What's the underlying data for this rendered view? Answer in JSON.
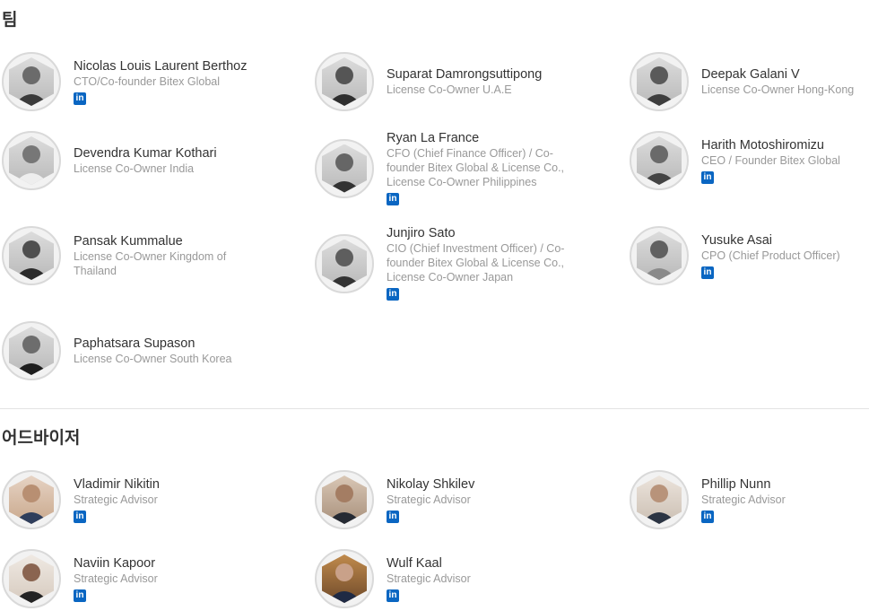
{
  "team": {
    "title": "팀",
    "members": [
      {
        "name": "Nicolas Louis Laurent Berthoz",
        "role": "CTO/Co-founder Bitex Global",
        "linkedin": true
      },
      {
        "name": "Suparat Damrongsuttipong",
        "role": "License Co-Owner U.A.E",
        "linkedin": false
      },
      {
        "name": "Deepak Galani V",
        "role": "License Co-Owner Hong-Kong",
        "linkedin": false
      },
      {
        "name": "Devendra Kumar Kothari",
        "role": "License Co-Owner India",
        "linkedin": false
      },
      {
        "name": "Ryan La France",
        "role": "CFO (Chief Finance Officer) / Co-founder Bitex Global & License Co., License Co-Owner Philippines",
        "linkedin": true
      },
      {
        "name": "Harith Motoshiromizu",
        "role": "CEO / Founder Bitex Global",
        "linkedin": true
      },
      {
        "name": "Pansak Kummalue",
        "role": "License Co-Owner Kingdom of Thailand",
        "linkedin": false
      },
      {
        "name": "Junjiro Sato",
        "role": "CIO (Chief Investment Officer) / Co-founder Bitex Global & License Co., License Co-Owner Japan",
        "linkedin": true
      },
      {
        "name": "Yusuke Asai",
        "role": "CPO (Chief Product Officer)",
        "linkedin": true
      },
      {
        "name": "Paphatsara Supason",
        "role": "License Co-Owner South Korea",
        "linkedin": false
      }
    ]
  },
  "advisors": {
    "title": "어드바이저",
    "members": [
      {
        "name": "Vladimir Nikitin",
        "role": "Strategic Advisor",
        "linkedin": true
      },
      {
        "name": "Nikolay Shkilev",
        "role": "Strategic Advisor",
        "linkedin": true
      },
      {
        "name": "Phillip Nunn",
        "role": "Strategic Advisor",
        "linkedin": true
      },
      {
        "name": "Naviin Kapoor",
        "role": "Strategic Advisor",
        "linkedin": true
      },
      {
        "name": "Wulf Kaal",
        "role": "Strategic Advisor",
        "linkedin": true
      }
    ]
  },
  "icons": {
    "linkedin": "linkedin-icon",
    "linkedin_glyph": "in",
    "linkedin_color": "#0a66c2"
  }
}
